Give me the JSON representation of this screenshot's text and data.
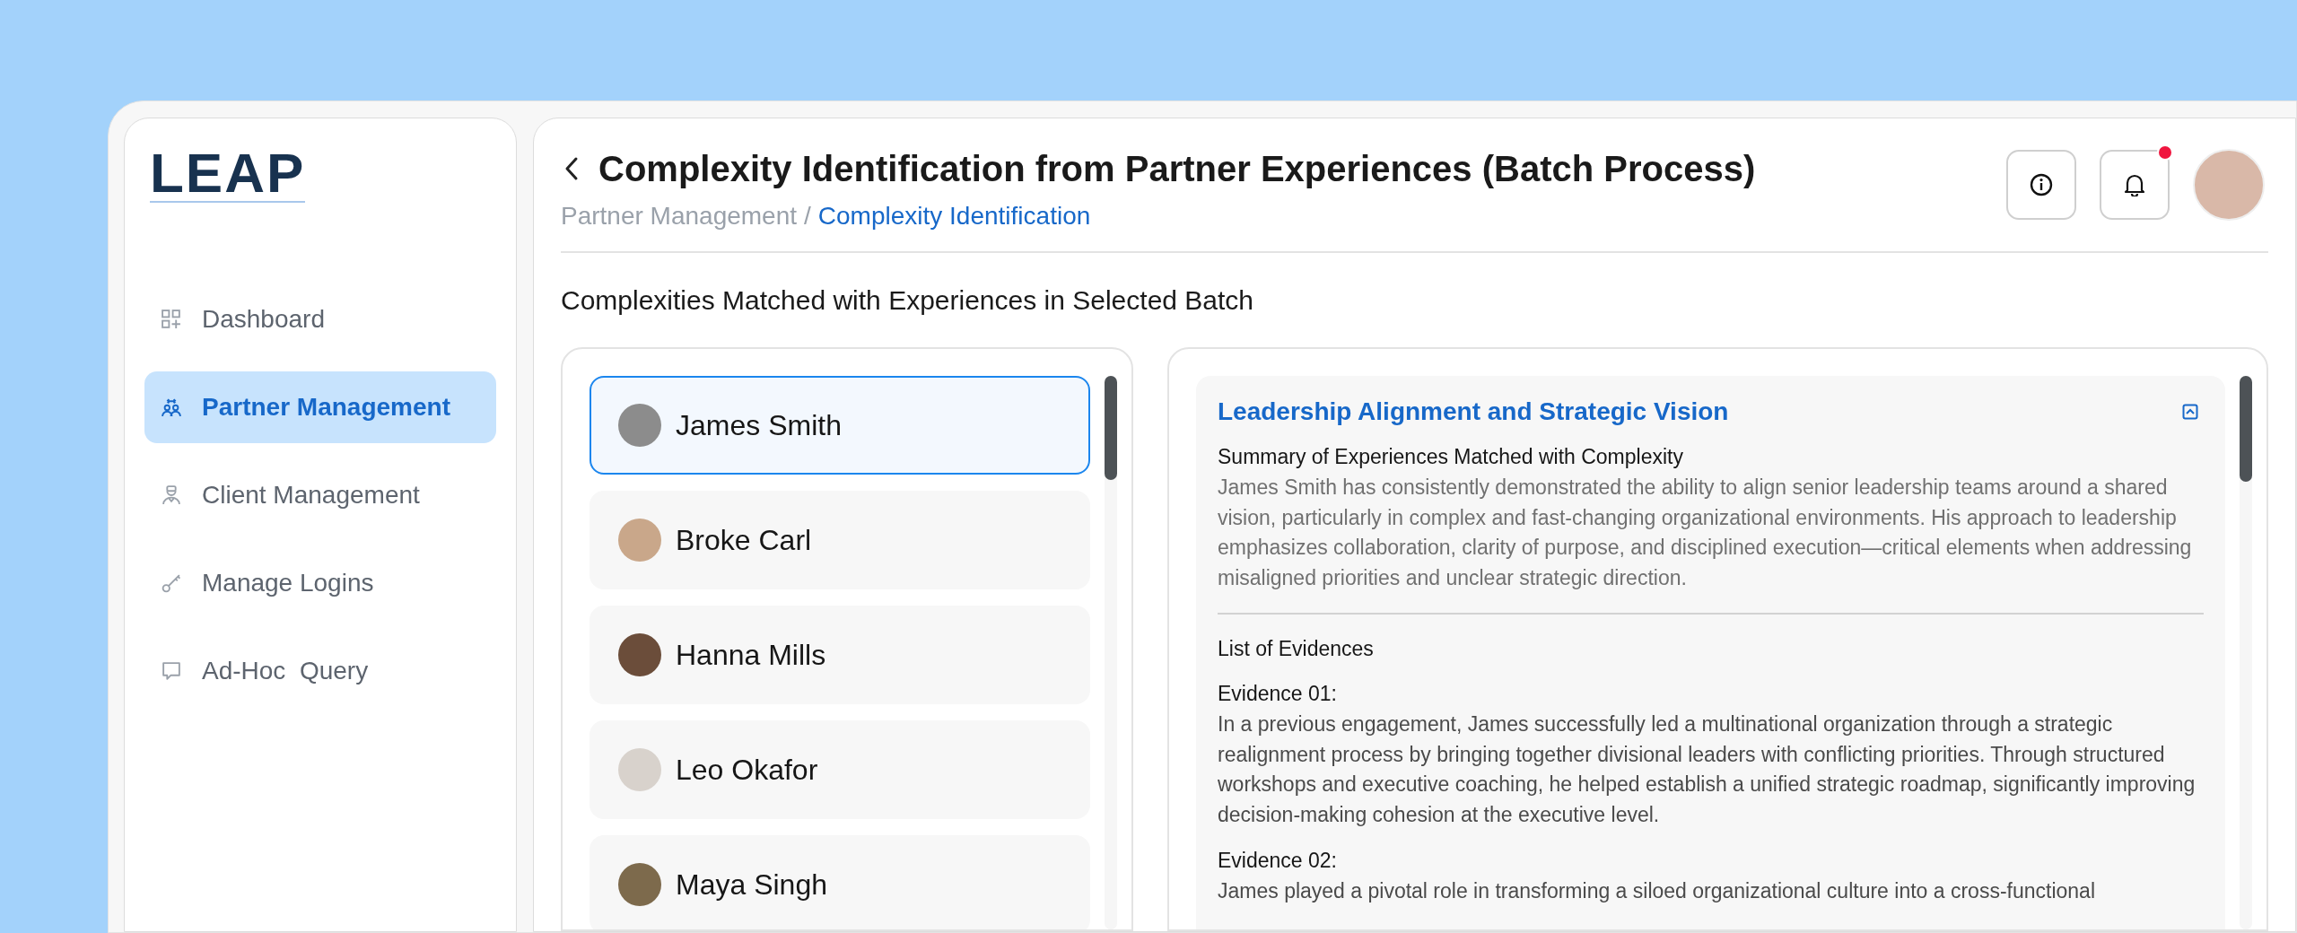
{
  "logo": "LEAP",
  "sidebar": {
    "items": [
      {
        "label": "Dashboard",
        "selected": false
      },
      {
        "label": "Partner Management",
        "selected": true
      },
      {
        "label": "Client Management",
        "selected": false
      },
      {
        "label": "Manage Logins",
        "selected": false
      },
      {
        "label": "Ad-Hoc  Query",
        "selected": false
      }
    ]
  },
  "header": {
    "title": "Complexity Identification from Partner Experiences (Batch Process)",
    "breadcrumb": [
      "Partner Management",
      "Complexity Identification"
    ],
    "breadcrumb_separator": "/",
    "notifications_unread": true
  },
  "section_title": "Complexities Matched with Experiences in Selected Batch",
  "partners": [
    {
      "name": "James Smith",
      "selected": true
    },
    {
      "name": "Broke Carl",
      "selected": false
    },
    {
      "name": "Hanna Mills",
      "selected": false
    },
    {
      "name": "Leo Okafor",
      "selected": false
    },
    {
      "name": "Maya Singh",
      "selected": false
    }
  ],
  "complexity": {
    "title": "Leadership Alignment and Strategic Vision",
    "summary_heading": "Summary of Experiences Matched with Complexity",
    "summary": "James Smith has consistently demonstrated the ability to align senior leadership teams around a shared vision, particularly in complex and fast-changing organizational environments. His approach to leadership emphasizes collaboration, clarity of purpose, and disciplined execution—critical elements when addressing misaligned priorities and unclear strategic direction.",
    "evidence_heading": "List of Evidences",
    "evidences": [
      {
        "label": "Evidence 01:",
        "text": "In a previous engagement, James successfully led a multinational organization through a strategic realignment process by bringing together divisional leaders with conflicting priorities. Through structured workshops and executive coaching, he helped establish a unified strategic roadmap, significantly improving decision-making cohesion at the executive level."
      },
      {
        "label": "Evidence 02:",
        "text": "James played a pivotal role in transforming a siloed organizational culture into a cross-functional"
      }
    ]
  }
}
